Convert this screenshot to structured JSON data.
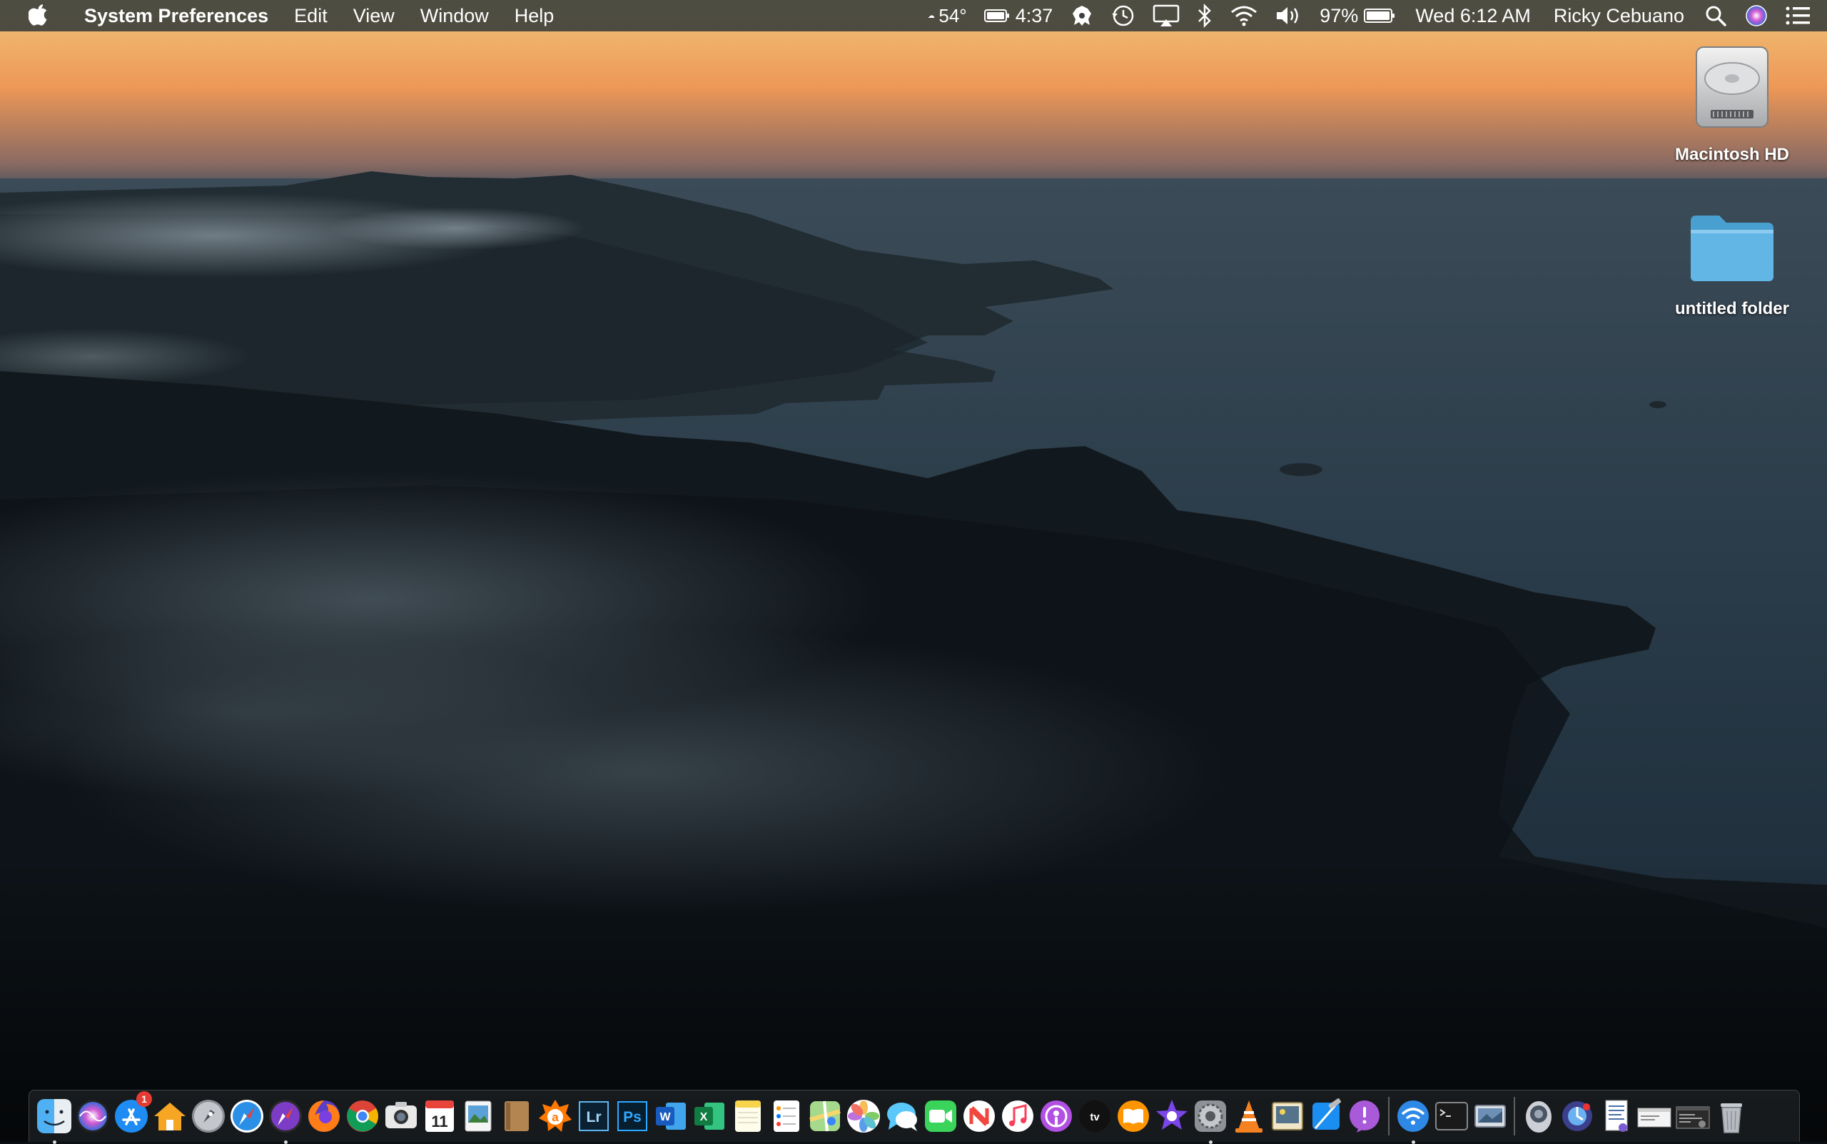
{
  "menubar": {
    "app_name": "System Preferences",
    "menus": [
      "Edit",
      "View",
      "Window",
      "Help"
    ],
    "weather": "54°",
    "battery_time": "4:37",
    "battery_percent": "97%",
    "clock": "Wed 6:12 AM",
    "user": "Ricky Cebuano",
    "icons": [
      "apple-icon",
      "weather-icon",
      "battery-icon",
      "malwarebytes-icon",
      "time-machine-icon",
      "airplay-icon",
      "bluetooth-icon",
      "wifi-icon",
      "volume-icon",
      "battery-icon",
      "spotlight-icon",
      "siri-icon",
      "notification-center-icon"
    ]
  },
  "desktop": {
    "icons": [
      {
        "label": "Macintosh HD",
        "icon": "hard-drive-icon"
      },
      {
        "label": "untitled folder",
        "icon": "folder-icon"
      }
    ]
  },
  "dock": {
    "apps": [
      {
        "name": "Finder",
        "icon": "finder-icon",
        "running": true
      },
      {
        "name": "Siri",
        "icon": "siri-icon"
      },
      {
        "name": "App Store",
        "icon": "app-store-icon",
        "badge": "1"
      },
      {
        "name": "Home",
        "icon": "home-icon"
      },
      {
        "name": "Launchpad",
        "icon": "launchpad-icon"
      },
      {
        "name": "Safari",
        "icon": "safari-icon"
      },
      {
        "name": "Safari Technology Preview",
        "icon": "safari-preview-icon",
        "running": true
      },
      {
        "name": "Firefox",
        "icon": "firefox-icon"
      },
      {
        "name": "Google Chrome",
        "icon": "chrome-icon"
      },
      {
        "name": "Screenshot",
        "icon": "screenshot-icon"
      },
      {
        "name": "Calendar",
        "icon": "calendar-icon",
        "text": "11"
      },
      {
        "name": "Preview",
        "icon": "preview-icon"
      },
      {
        "name": "Notes Book",
        "icon": "notebook-icon"
      },
      {
        "name": "Avast",
        "icon": "avast-icon"
      },
      {
        "name": "Lightroom",
        "icon": "lightroom-icon",
        "text": "Lr"
      },
      {
        "name": "Photoshop",
        "icon": "photoshop-icon",
        "text": "Ps"
      },
      {
        "name": "Word",
        "icon": "word-icon",
        "text": "W"
      },
      {
        "name": "Excel",
        "icon": "excel-icon",
        "text": "X"
      },
      {
        "name": "Notes",
        "icon": "notes-icon"
      },
      {
        "name": "Reminders",
        "icon": "reminders-icon"
      },
      {
        "name": "Maps",
        "icon": "maps-icon"
      },
      {
        "name": "Photos",
        "icon": "photos-icon"
      },
      {
        "name": "Messages",
        "icon": "messages-icon"
      },
      {
        "name": "FaceTime",
        "icon": "facetime-icon"
      },
      {
        "name": "News",
        "icon": "news-icon"
      },
      {
        "name": "Music",
        "icon": "music-icon"
      },
      {
        "name": "Podcasts",
        "icon": "podcasts-icon"
      },
      {
        "name": "TV",
        "icon": "tv-icon",
        "text": "tv"
      },
      {
        "name": "Books",
        "icon": "books-icon"
      },
      {
        "name": "iMovie",
        "icon": "imovie-icon"
      },
      {
        "name": "System Preferences",
        "icon": "system-preferences-icon",
        "running": true
      },
      {
        "name": "VLC",
        "icon": "vlc-icon"
      },
      {
        "name": "Preview Alt",
        "icon": "image-viewer-icon"
      },
      {
        "name": "Xcode",
        "icon": "xcode-icon"
      },
      {
        "name": "Feedback Assistant",
        "icon": "feedback-icon"
      }
    ],
    "utilities": [
      {
        "name": "Wireless Diagnostics",
        "icon": "wireless-diagnostics-icon",
        "running": true
      },
      {
        "name": "Terminal",
        "icon": "terminal-icon"
      },
      {
        "name": "Screen Image",
        "icon": "screen-image-icon"
      }
    ],
    "stacks": [
      {
        "name": "Downloads",
        "icon": "downloads-stack-icon"
      },
      {
        "name": "Recent",
        "icon": "recent-stack-icon"
      },
      {
        "name": "Documents",
        "icon": "document-stack-icon"
      },
      {
        "name": "Window 1",
        "icon": "window-thumbnail-icon"
      },
      {
        "name": "Window 2",
        "icon": "window-thumbnail-icon"
      },
      {
        "name": "Trash",
        "icon": "trash-icon"
      }
    ]
  }
}
